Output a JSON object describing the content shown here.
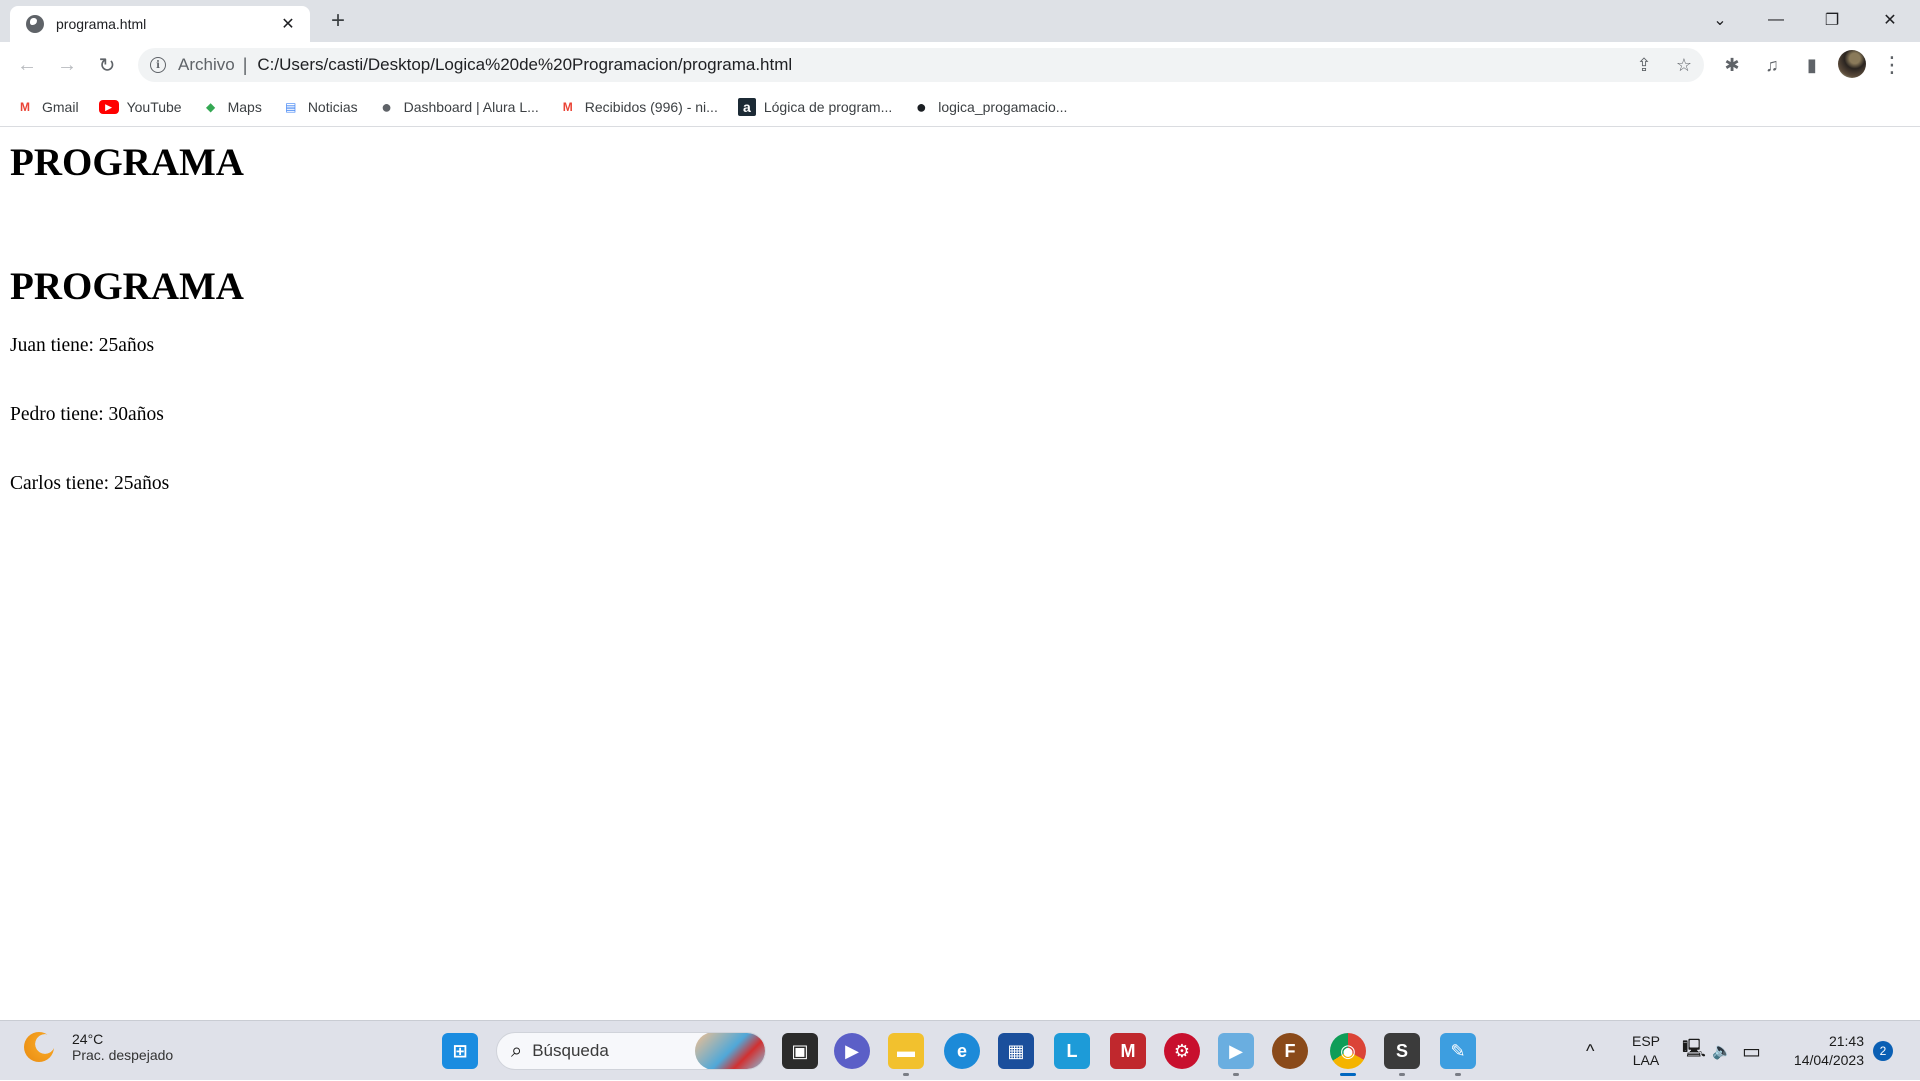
{
  "browser": {
    "tab": {
      "title": "programa.html",
      "close_glyph": "✕",
      "favicon": "globe-icon"
    },
    "new_tab_glyph": "+",
    "window_controls": {
      "tab_search": "⌄",
      "minimize": "—",
      "restore": "❐",
      "close": "✕"
    },
    "nav": {
      "back": "←",
      "forward": "→",
      "reload": "↻"
    },
    "omnibox": {
      "info_glyph": "i",
      "scheme_label": "Archivo",
      "separator": "|",
      "url": "C:/Users/casti/Desktop/Logica%20de%20Programacion/programa.html",
      "share_glyph": "⇪",
      "star_glyph": "☆"
    },
    "toolbar_icons": {
      "extensions": "✱",
      "media": "♫",
      "side_panel": "▮",
      "menu": "⋮"
    },
    "bookmarks": [
      {
        "label": "Gmail",
        "icon": "gmail-icon",
        "glyph": "M",
        "color": "#ea4335"
      },
      {
        "label": "YouTube",
        "icon": "youtube-icon",
        "glyph": "▶",
        "color": "#ff0000"
      },
      {
        "label": "Maps",
        "icon": "maps-icon",
        "glyph": "◆",
        "color": "#34a853"
      },
      {
        "label": "Noticias",
        "icon": "news-icon",
        "glyph": "▤",
        "color": "#4285f4"
      },
      {
        "label": "Dashboard | Alura L...",
        "icon": "globe-icon",
        "glyph": "●",
        "color": "#5f6368"
      },
      {
        "label": "Recibidos (996) - ni...",
        "icon": "gmail-icon",
        "glyph": "M",
        "color": "#ea4335"
      },
      {
        "label": "Lógica de program...",
        "icon": "alura-icon",
        "glyph": "a",
        "color": "#1c2a35"
      },
      {
        "label": "logica_progamacio...",
        "icon": "github-icon",
        "glyph": "●",
        "color": "#1b1f23"
      }
    ]
  },
  "page": {
    "headings": [
      "PROGRAMA",
      "PROGRAMA"
    ],
    "lines": [
      "Juan tiene: 25años",
      "Pedro tiene: 30años",
      "Carlos tiene: 25años"
    ]
  },
  "taskbar": {
    "weather": {
      "temperature": "24°C",
      "condition": "Prac. despejado"
    },
    "search_placeholder": "Búsqueda",
    "search_glyph": "⌕",
    "apps": [
      {
        "name": "start",
        "glyph": "⊞",
        "color": "#1a8ce0"
      },
      {
        "name": "task-view",
        "glyph": "▣",
        "color": "#2b2b2b"
      },
      {
        "name": "teams-chat",
        "glyph": "▶",
        "color": "#5b5fc7"
      },
      {
        "name": "file-explorer",
        "glyph": "▬",
        "color": "#f2c12e"
      },
      {
        "name": "edge",
        "glyph": "e",
        "color": "#1c8ad8"
      },
      {
        "name": "microsoft-store",
        "glyph": "▦",
        "color": "#1b4f9c"
      },
      {
        "name": "l-app",
        "glyph": "L",
        "color": "#1d9bd8"
      },
      {
        "name": "mcafee",
        "glyph": "M",
        "color": "#c0282d"
      },
      {
        "name": "driver-booster",
        "glyph": "⚙",
        "color": "#c8102e"
      },
      {
        "name": "media-player",
        "glyph": "▶",
        "color": "#6aaee0"
      },
      {
        "name": "crossfire",
        "glyph": "F",
        "color": "#8a4a1a"
      },
      {
        "name": "chrome",
        "glyph": "◉",
        "color": "#db4437"
      },
      {
        "name": "sublime-text",
        "glyph": "S",
        "color": "#3b3b3b"
      },
      {
        "name": "paint",
        "glyph": "✎",
        "color": "#3d9ee0"
      }
    ],
    "tray": {
      "overflow_glyph": "^",
      "lang_top": "ESP",
      "lang_bottom": "LAA",
      "network_glyph": "🖳",
      "volume_glyph": "🔈",
      "battery_glyph": "▭",
      "time": "21:43",
      "date": "14/04/2023",
      "notifications": "2"
    }
  }
}
